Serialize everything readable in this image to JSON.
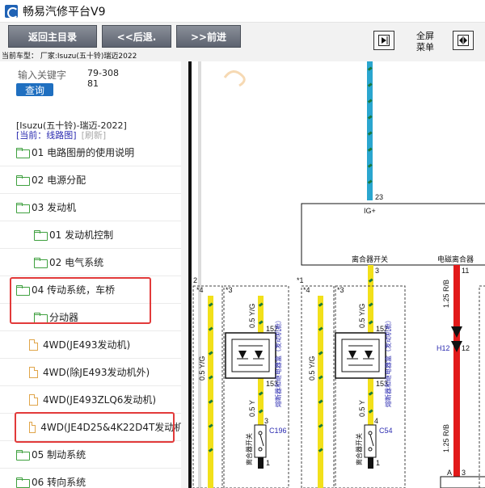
{
  "app": {
    "title": "畅易汽修平台V9"
  },
  "toolbar": {
    "home_label": "返回主目录",
    "back_label": "<<后退.",
    "forward_label": ">>前进",
    "fullscreen_line1": "全屏",
    "fullscreen_line2": "菜单"
  },
  "vehicle": {
    "current_model": "当前车型： 厂家:Isuzu(五十铃)瑞迈2022"
  },
  "search": {
    "label": "输入关键字",
    "value": "79-30881",
    "button": "查询"
  },
  "tree": {
    "brand": "[Isuzu(五十铃)-瑞迈-2022]",
    "current": "[当前：线路图]",
    "refresh": "[刷新]",
    "items": [
      {
        "label": "01 电路图册的使用说明"
      },
      {
        "label": "02 电源分配"
      },
      {
        "label": "03 发动机"
      },
      {
        "label": "01 发动机控制"
      },
      {
        "label": "02 电气系统"
      },
      {
        "label": "04 传动系统，车桥"
      },
      {
        "label": "分动器"
      },
      {
        "label": "4WD(JE493发动机)"
      },
      {
        "label": "4WD(除JE493发动机外)"
      },
      {
        "label": "4WD(JE493ZLQ6发动机)"
      },
      {
        "label": "4WD(JE4D25&4K22D4T发动机)"
      },
      {
        "label": "05 制动系统"
      },
      {
        "label": "06 转向系统"
      }
    ]
  },
  "diagram": {
    "labels": {
      "pin23": "23",
      "ig": "IG+",
      "clutch_switch": "离合器开关",
      "em_clutch": "电磁离合器",
      "pin11": "11",
      "pin3": "3",
      "pin2": "2",
      "pin1": "1",
      "star1": "*1",
      "star3": "*3",
      "star4": "*4",
      "wire_05yg": "0.5 Y/G",
      "wire_05y": "0.5 Y",
      "wire_125rb": "1.25 R/B",
      "pin152": "152",
      "pin153": "153",
      "pin12": "12",
      "h12": "H12",
      "relay_box": "熔断器和继电器盒（发动机舱）",
      "c196": "C196",
      "c54": "C54",
      "a3": "A",
      "pin4": "4",
      "clutch_sw_vert": "离合器开关"
    }
  }
}
